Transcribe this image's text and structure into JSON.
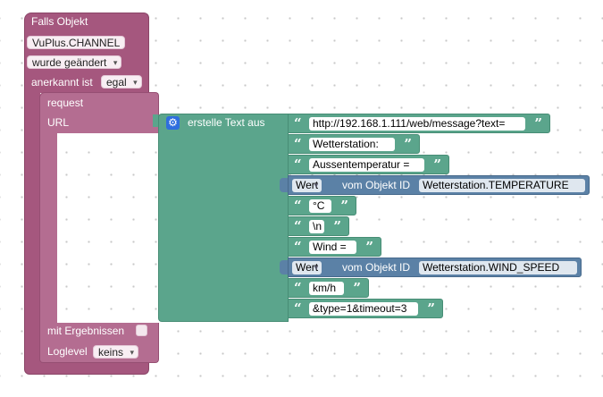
{
  "event": {
    "title": "Falls Objekt",
    "object_id": "VuPlus.CHANNEL",
    "trigger_option": "wurde geändert",
    "ack_label": "anerkannt ist",
    "ack_value": "egal"
  },
  "request": {
    "title": "request",
    "url_label": "URL",
    "results_label": "mit Ergebnissen",
    "loglevel_label": "Loglevel",
    "loglevel_value": "keins"
  },
  "join": {
    "label": "erstelle Text aus"
  },
  "quote_open": "“",
  "quote_close": "”",
  "items": [
    {
      "type": "text",
      "value": "http://192.168.1.111/web/message?text="
    },
    {
      "type": "text",
      "value": "Wetterstation:"
    },
    {
      "type": "text",
      "value": "Aussentemperatur ="
    },
    {
      "type": "state",
      "attr": "Wert",
      "mid": "vom Objekt ID",
      "id": "Wetterstation.TEMPERATURE"
    },
    {
      "type": "text",
      "value": "°C"
    },
    {
      "type": "text",
      "value": "\\n"
    },
    {
      "type": "text",
      "value": "Wind ="
    },
    {
      "type": "state",
      "attr": "Wert",
      "mid": "vom Objekt ID",
      "id": "Wetterstation.WIND_SPEED"
    },
    {
      "type": "text",
      "value": "km/h"
    },
    {
      "type": "text",
      "value": "&type=1&timeout=3"
    }
  ],
  "colors": {
    "event_block": "#a5577e",
    "request_block": "#b46d91",
    "text_block": "#5ba58c",
    "state_block": "#5b81a6",
    "gear": "#2f6ede"
  },
  "icons": {
    "dropdown": "▾",
    "gear": "⚙"
  }
}
